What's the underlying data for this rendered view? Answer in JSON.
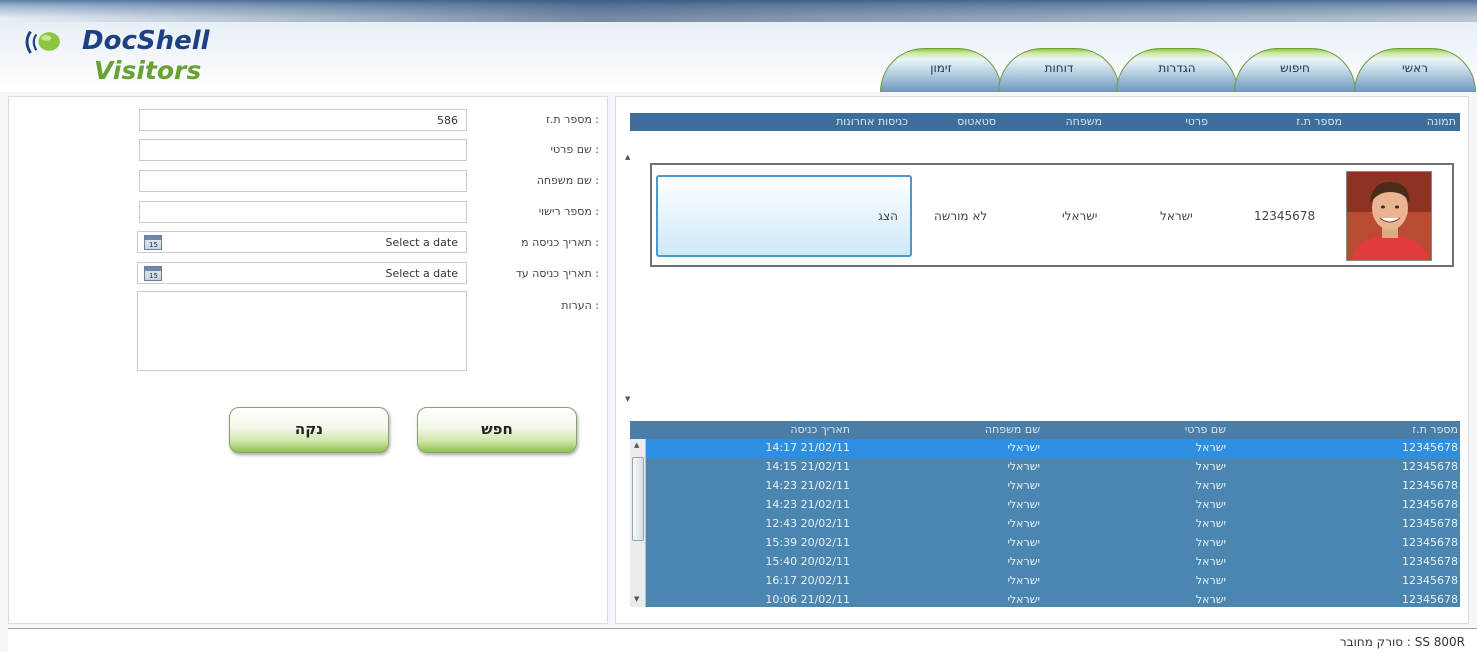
{
  "app": {
    "logo_brand_prefix": "Doc",
    "logo_brand_suffix": "Shell",
    "logo_subtitle": "Visitors"
  },
  "tabs": [
    {
      "label": "זימון"
    },
    {
      "label": "דוחות"
    },
    {
      "label": "הגדרות"
    },
    {
      "label": "חיפוש"
    },
    {
      "label": "ראשי"
    }
  ],
  "form": {
    "id_label": "מספר ת.ז :",
    "id_value": "586",
    "first_name_label": "שם פרטי :",
    "last_name_label": "שם משפחה :",
    "license_label": "מספר רישוי :",
    "date_from_label": "תאריך כניסה מ :",
    "date_from_placeholder": "Select a date",
    "date_to_label": "תאריך כניסה עד :",
    "date_to_placeholder": "Select a date",
    "notes_label": "הערות :",
    "search_button": "חפש",
    "clear_button": "נקה"
  },
  "results": {
    "columns": [
      "תמונה",
      "מספר ת.ז",
      "פרטי",
      "משפחה",
      "סטאטוס",
      "כניסות אחרונות"
    ],
    "card": {
      "id": "12345678",
      "first_name": "ישראל",
      "last_name": "ישראלי",
      "status": "לא מורשה",
      "action": "הצג"
    }
  },
  "history": {
    "columns": [
      "מספר ת.ז",
      "שם פרטי",
      "שם משפחה",
      "תאריך כניסה"
    ],
    "rows": [
      {
        "id": "12345678",
        "first": "ישראל",
        "last": "ישראלי",
        "date": "14:17 21/02/11"
      },
      {
        "id": "12345678",
        "first": "ישראל",
        "last": "ישראלי",
        "date": "14:15 21/02/11"
      },
      {
        "id": "12345678",
        "first": "ישראל",
        "last": "ישראלי",
        "date": "14:23 21/02/11"
      },
      {
        "id": "12345678",
        "first": "ישראל",
        "last": "ישראלי",
        "date": "14:23 21/02/11"
      },
      {
        "id": "12345678",
        "first": "ישראל",
        "last": "ישראלי",
        "date": "12:43 20/02/11"
      },
      {
        "id": "12345678",
        "first": "ישראל",
        "last": "ישראלי",
        "date": "15:39 20/02/11"
      },
      {
        "id": "12345678",
        "first": "ישראל",
        "last": "ישראלי",
        "date": "15:40 20/02/11"
      },
      {
        "id": "12345678",
        "first": "ישראל",
        "last": "ישראלי",
        "date": "16:17 20/02/11"
      },
      {
        "id": "12345678",
        "first": "ישראל",
        "last": "ישראלי",
        "date": "10:06 21/02/11"
      }
    ]
  },
  "status_bar": {
    "text": "סורק מחובר : SS 800R"
  },
  "colors": {
    "header_blue": "#3d6e9c",
    "grid_blue": "#4a86b0",
    "selected_row": "#2e8fe2",
    "button_green": "#8fc14a",
    "logo_blue": "#1e3f82",
    "logo_green": "#6aa232"
  }
}
